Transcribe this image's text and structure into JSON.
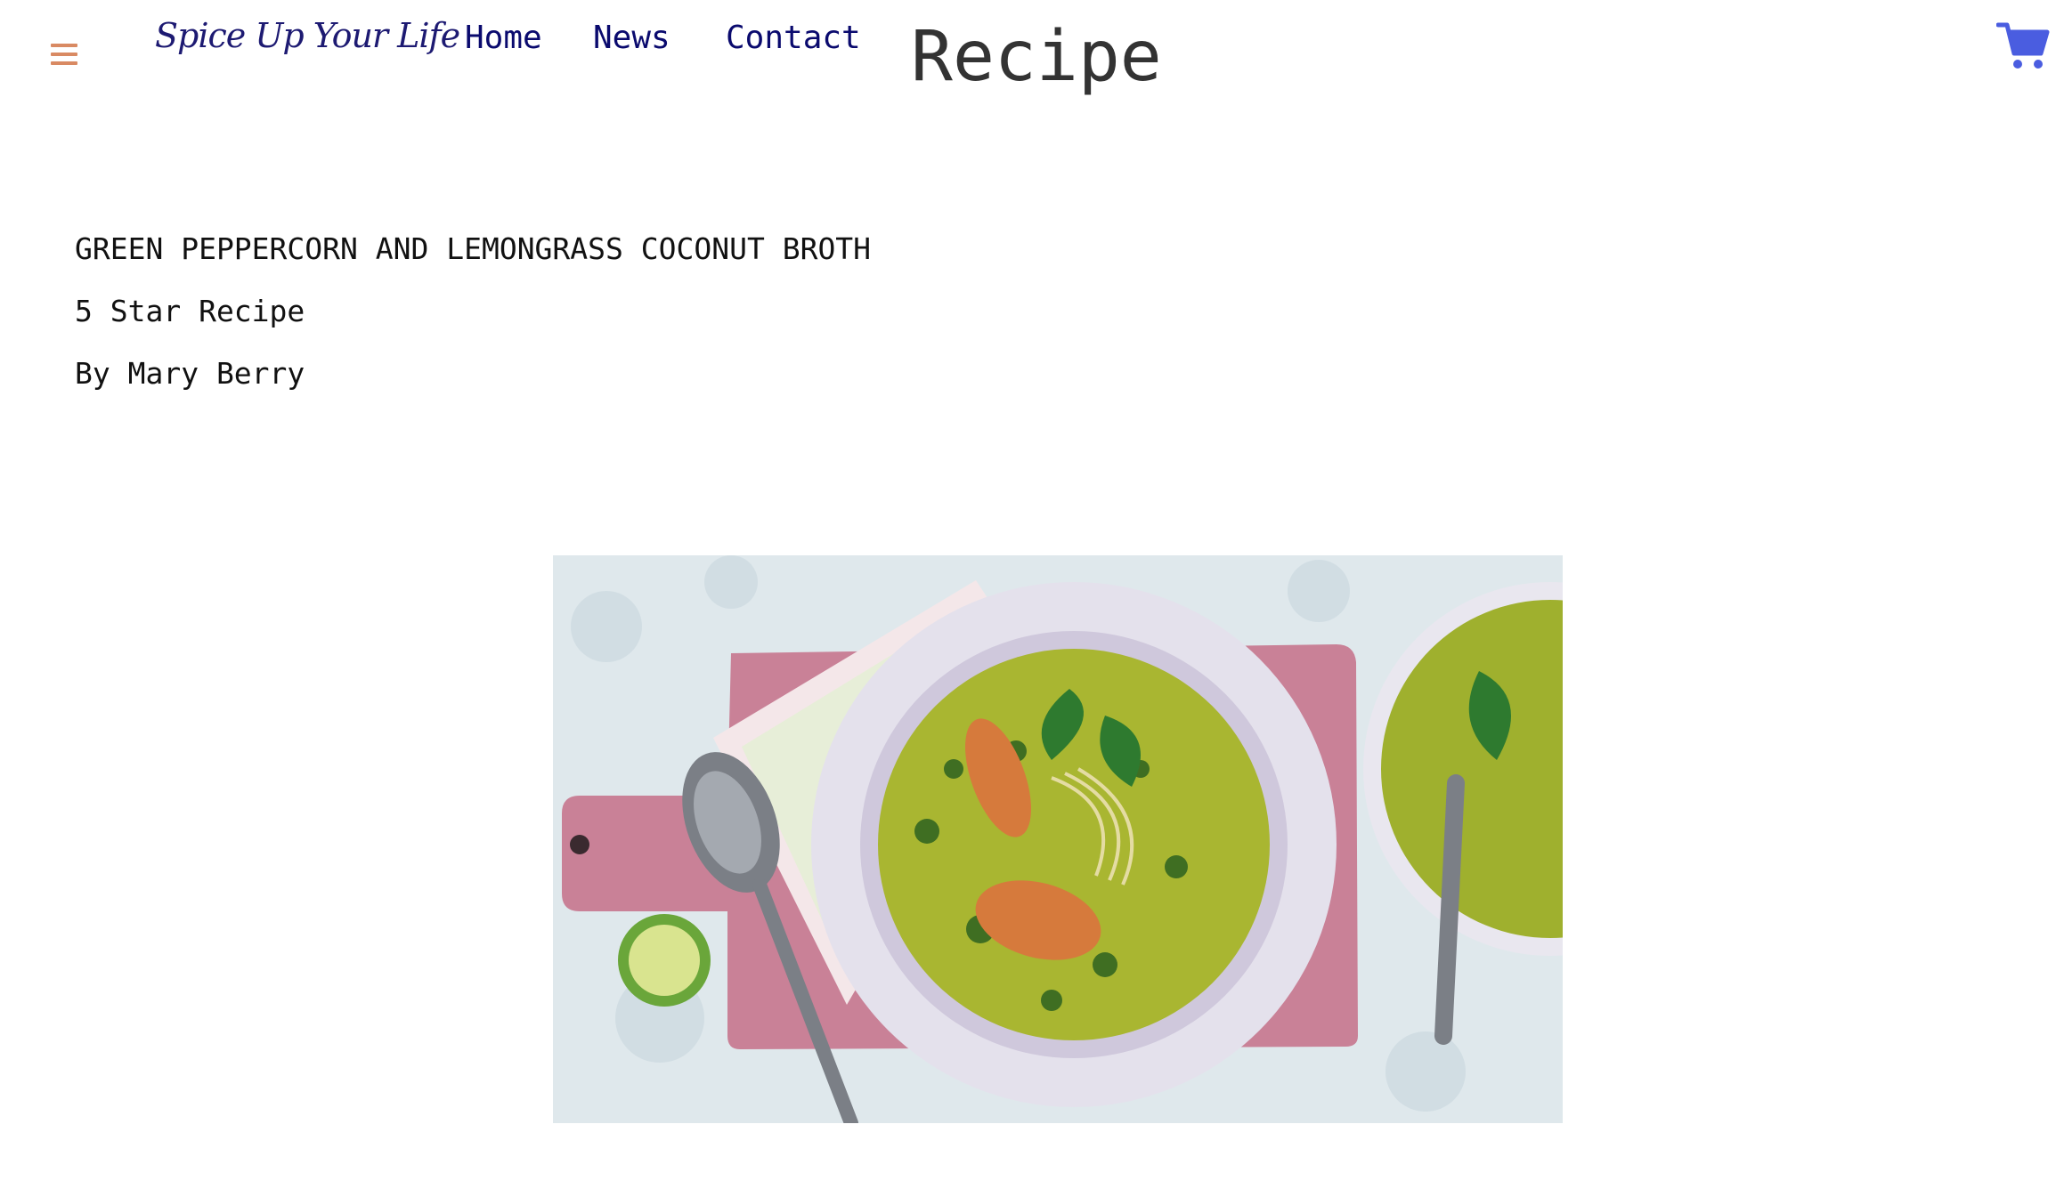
{
  "header": {
    "menu_icon": "hamburger-menu-icon",
    "brand": "Spice Up Your Life",
    "nav": [
      {
        "label": "Home"
      },
      {
        "label": "News"
      },
      {
        "label": "Contact"
      }
    ],
    "page_title": "Recipe",
    "cart_icon": "shopping-cart-icon"
  },
  "recipe": {
    "title": "GREEN PEPPERCORN AND LEMONGRASS COCONUT BROTH",
    "rating_text": "5 Star Recipe",
    "author": "By Mary Berry"
  },
  "colors": {
    "menu_icon": "#d98a63",
    "brand": "#1d1a72",
    "nav_link": "#0a0a6e",
    "title": "#333333",
    "cart_icon": "#4a5de0",
    "body_text": "#111111"
  }
}
